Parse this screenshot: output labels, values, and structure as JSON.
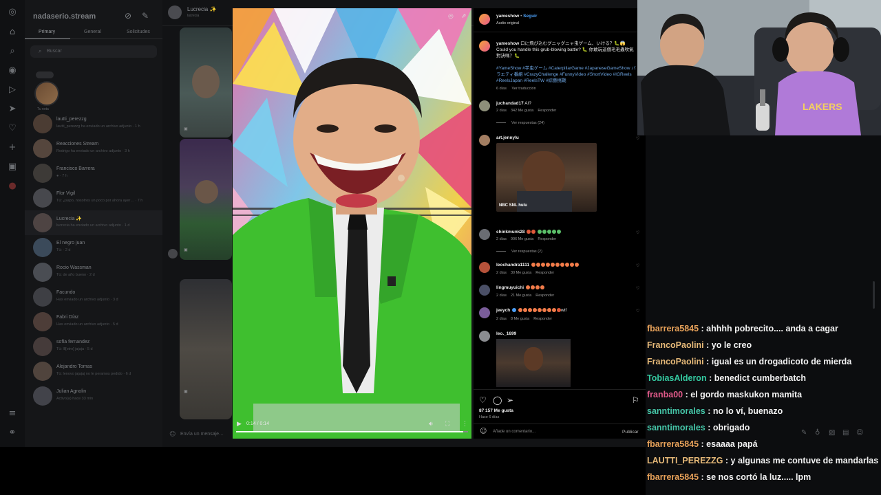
{
  "instagram": {
    "sidebar": {
      "account": "nadaserio.stream",
      "tabs": [
        "Primary",
        "General",
        "Solicitudes"
      ],
      "search_placeholder": "Buscar",
      "note_label": "Tu nota",
      "conversations": [
        {
          "name": "lautti_perezzg",
          "preview": "lautti_perezzg ha enviado un archivo adjunto · 1 h"
        },
        {
          "name": "Reacciones Stream",
          "preview": "Rodrigo ha enviado un archivo adjunto · 3 h"
        },
        {
          "name": "Francisco Barrera",
          "preview": "● · 7 h"
        },
        {
          "name": "Flor Vigil",
          "preview": "Tú: ¿sapo, nosotros un poco por ahora ayer… · 7 h"
        },
        {
          "name": "Lucrecia ✨",
          "preview": "lucrecia ha enviado un archivo adjunto · 1 d"
        },
        {
          "name": "El negro juan",
          "preview": "Tú: · 2 d"
        },
        {
          "name": "Rocio Wassman",
          "preview": "Tú: de año bueno · 2 d"
        },
        {
          "name": "Facundo",
          "preview": "Has enviado un archivo adjunto · 3 d"
        },
        {
          "name": "Fabri Díaz",
          "preview": "Has enviado un archivo adjunto · 5 d"
        },
        {
          "name": "sofía fernandez",
          "preview": "Tú: lll[otro] jajaja · 5 d"
        },
        {
          "name": "Alejandro Tomas",
          "preview": "Tú: lenovo jajajaj no le peramos pedido · 6 d"
        },
        {
          "name": "Julian Agnolin",
          "preview": "Activo(a) hace 33 min"
        }
      ]
    },
    "thread": {
      "name": "Lucrecia ✨",
      "sub": "lucrecia",
      "input_placeholder": "Envía un mensaje…"
    },
    "reel": {
      "time": "0:14 / 0:14",
      "progress": 0.98
    },
    "post": {
      "author": "yameshow",
      "follow": "Seguir",
      "audio": "Audio original",
      "caption_user": "yameshow",
      "caption": "口に飛び込むグニャグニャ虫ゲーム、いける？🐛😱 Could you handle this grub-blowing battle? 🐛 你敢玩這個毛毛蟲吹氣對決嗎？🐛",
      "hashtags": "#YameShow #芋虫ゲーム #CaterpillarGame #JapaneseGameShow バラエティ番組 #CrazyChallenge #FunnyVideo #ShortVideo #IGReels #ReelsJapan #ReelsTW #綜藝挑戰",
      "caption_meta": {
        "age": "6 días",
        "translate": "Ver traducción"
      },
      "likes": "87 157 Me gusta",
      "date": "Hace 6 días",
      "add_comment_placeholder": "Añade un comentario...",
      "publish": "Publicar"
    },
    "comments": [
      {
        "user": "juchandad17",
        "text": "AI?",
        "age": "2 días",
        "likes": "342 Me gusta",
        "reply": "Responder",
        "view_replies": "Ver respuestas (24)"
      },
      {
        "user": "art.jennylu",
        "text": "",
        "gif_caption": "NBC  SNL  hulu"
      },
      {
        "user": "chinkmunk28",
        "text": "",
        "age": "2 días",
        "likes": "906 Me gusta",
        "reply": "Responder",
        "view_replies": "Ver respuestas (2)"
      },
      {
        "user": "leochandra1111",
        "text": "",
        "age": "2 días",
        "likes": "30 Me gusta",
        "reply": "Responder"
      },
      {
        "user": "lingmuyuichi",
        "text": "",
        "age": "2 días",
        "likes": "21 Me gusta",
        "reply": "Responder"
      },
      {
        "user": "jeeych",
        "text": "wtf",
        "age": "2 días",
        "likes": "8 Me gusta",
        "reply": "Responder"
      },
      {
        "user": "leo._1699",
        "text": ""
      }
    ]
  },
  "chat": {
    "messages": [
      {
        "user": "fbarrera5845",
        "color": "#e8a25a",
        "text": ": ahhhh pobrecito.... anda a cagar"
      },
      {
        "user": "FrancoPaolini",
        "color": "#e6b978",
        "text": ": yo le creo"
      },
      {
        "user": "FrancoPaolini",
        "color": "#e6b978",
        "text": ": igual es un drogadicoto de mierda"
      },
      {
        "user": "TobiasAlderon",
        "color": "#34c9a0",
        "text": ": benedict cumberbatch"
      },
      {
        "user": "franba00",
        "color": "#e15a8a",
        "text": ": el gordo maskukon mamita"
      },
      {
        "user": "sanntimorales",
        "color": "#45c6a8",
        "text": ": no lo ví, buenazo"
      },
      {
        "user": "sanntimorales",
        "color": "#45c6a8",
        "text": ": obrigado"
      },
      {
        "user": "fbarrera5845",
        "color": "#e8a25a",
        "text": ": esaaaa papá"
      },
      {
        "user": "LAUTTI_PEREZZG",
        "color": "#e6b978",
        "text": ": y algunas me contuve de mandarlas"
      },
      {
        "user": "fbarrera5845",
        "color": "#e8a25a",
        "text": ": se nos cortó la luz..... lpm"
      }
    ]
  }
}
